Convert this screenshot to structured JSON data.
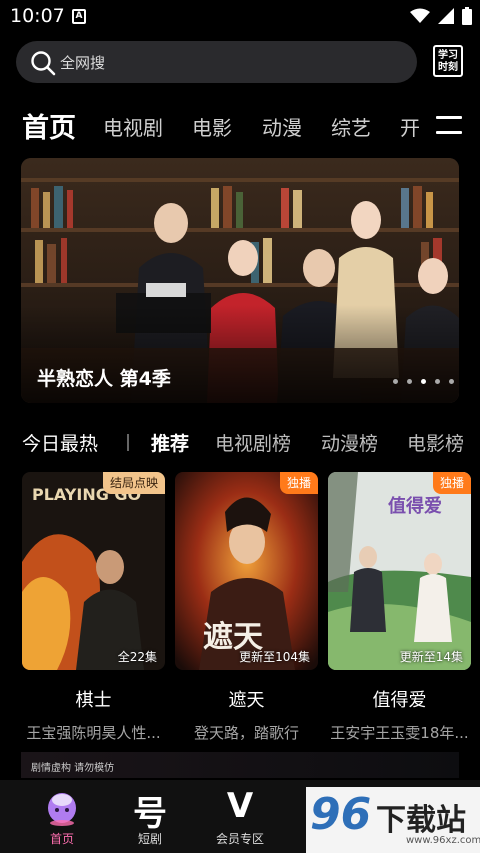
{
  "status_bar": {
    "time": "10:07",
    "notif_glyph": "A"
  },
  "search": {
    "placeholder": "全网搜",
    "learn_label_1": "学习",
    "learn_label_2": "时刻"
  },
  "categories": [
    "首页",
    "电视剧",
    "电影",
    "动漫",
    "综艺",
    "开"
  ],
  "banner": {
    "caption": "半熟恋人 第4季",
    "dot_count": 5,
    "active_dot": 2
  },
  "ranks": {
    "today": "今日最热",
    "tabs": [
      "推荐",
      "电视剧榜",
      "动漫榜",
      "电影榜"
    ]
  },
  "cards": [
    {
      "badge": "结局点映",
      "badge_color": "#f2c48b",
      "episodes": "全22集",
      "poster_text": "PLAYING GO",
      "title": "棋士",
      "desc": "王宝强陈明昊人性..."
    },
    {
      "badge": "独播",
      "badge_color": "#ff7a1a",
      "episodes": "更新至104集",
      "poster_text": "遮天",
      "title": "遮天",
      "desc": "登天路，踏歌行"
    },
    {
      "badge": "独播",
      "badge_color": "#ff7a1a",
      "episodes": "更新至14集",
      "poster_text": "值得爱",
      "title": "值得爱",
      "desc": "王安宇王玉雯18年..."
    }
  ],
  "disclaimer": "剧情虚构  请勿模仿",
  "tabbar": [
    {
      "label": "首页",
      "icon": "home-mascot-icon"
    },
    {
      "label": "短剧",
      "glyph": "号",
      "icon": "short-drama-icon"
    },
    {
      "label": "会员专区",
      "glyph": "V",
      "icon": "vip-icon"
    }
  ],
  "watermark": {
    "number": "96",
    "name": "下载站",
    "url": "www.96xz.com"
  },
  "colors": {
    "accent_pink": "#ff6fb0",
    "badge_orange": "#ff7a1a",
    "badge_gold": "#f2c48b"
  }
}
